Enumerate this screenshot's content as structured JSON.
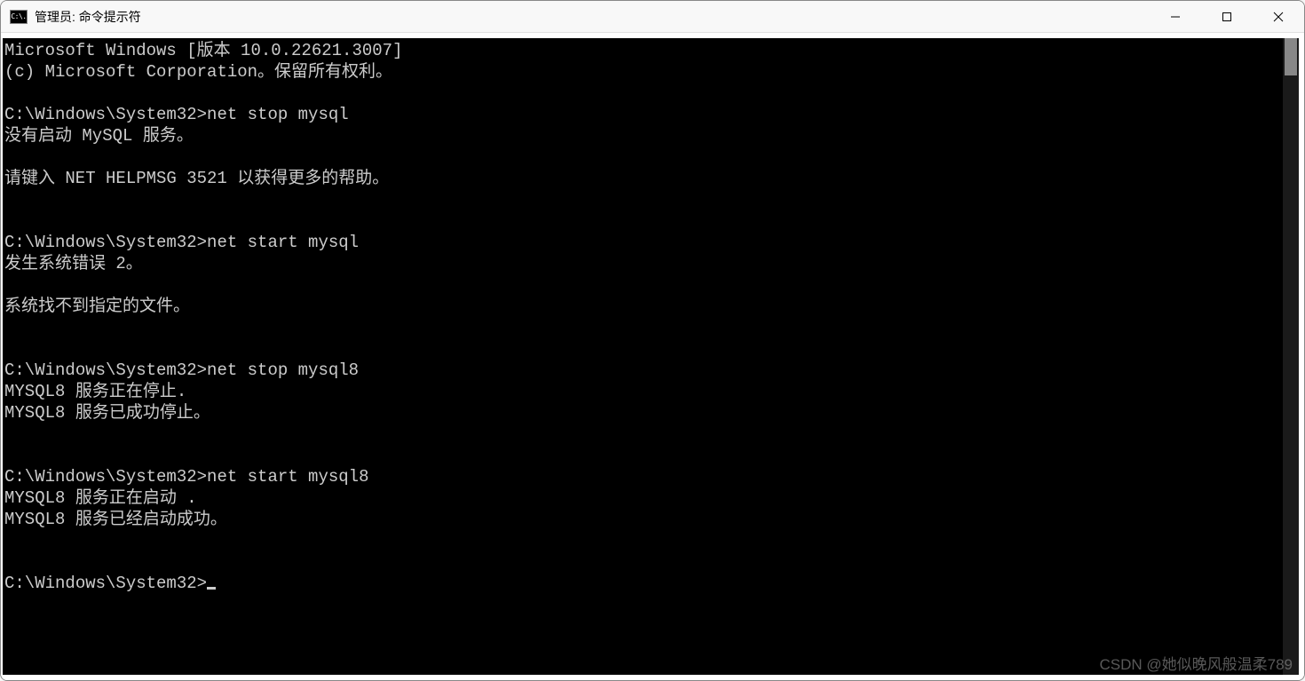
{
  "window": {
    "title": "管理员: 命令提示符",
    "icon_text": "C:\\."
  },
  "terminal": {
    "lines": [
      "Microsoft Windows [版本 10.0.22621.3007]",
      "(c) Microsoft Corporation。保留所有权利。",
      "",
      "C:\\Windows\\System32>net stop mysql",
      "没有启动 MySQL 服务。",
      "",
      "请键入 NET HELPMSG 3521 以获得更多的帮助。",
      "",
      "",
      "C:\\Windows\\System32>net start mysql",
      "发生系统错误 2。",
      "",
      "系统找不到指定的文件。",
      "",
      "",
      "C:\\Windows\\System32>net stop mysql8",
      "MYSQL8 服务正在停止.",
      "MYSQL8 服务已成功停止。",
      "",
      "",
      "C:\\Windows\\System32>net start mysql8",
      "MYSQL8 服务正在启动 .",
      "MYSQL8 服务已经启动成功。",
      "",
      ""
    ],
    "prompt": "C:\\Windows\\System32>"
  },
  "watermark": "CSDN @她似晚风般温柔789"
}
